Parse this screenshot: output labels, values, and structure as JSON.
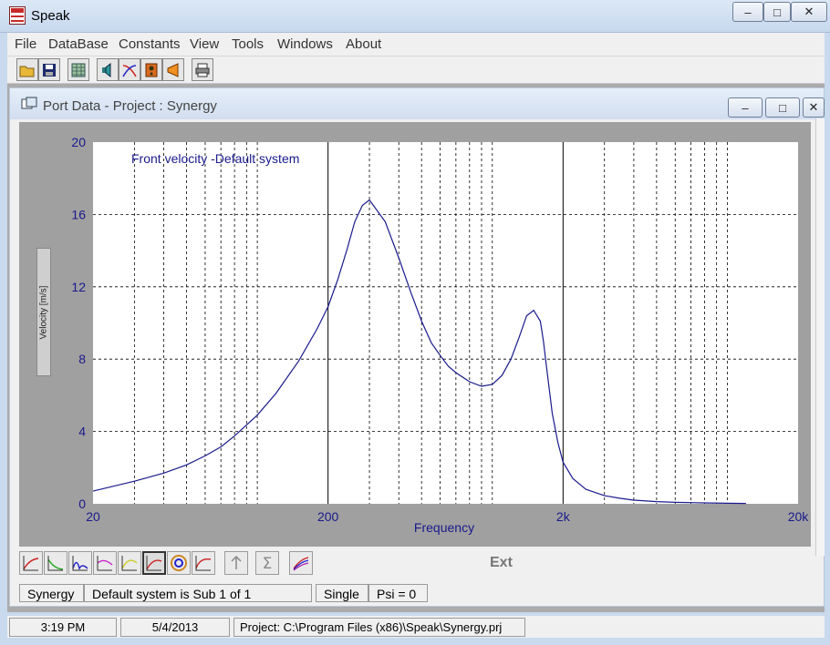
{
  "app": {
    "title": "Speak"
  },
  "window_controls": {
    "minimize": "‒",
    "maximize": "□",
    "close": "✕"
  },
  "menu": [
    "File",
    "DataBase",
    "Constants",
    "View",
    "Tools",
    "Windows",
    "About"
  ],
  "toolbar": {
    "icons": [
      "open-folder-icon",
      "save-icon",
      "grid-icon",
      "speaker-icon",
      "crossover-icon",
      "box-icon",
      "horn-icon",
      "print-icon"
    ]
  },
  "child_window": {
    "title": "Port Data - Project : Synergy",
    "controls": {
      "minimize": "‒",
      "maximize": "□",
      "close": "✕"
    }
  },
  "chart_data": {
    "type": "line",
    "title": "Front velocity -Default system",
    "xlabel": "Frequency",
    "ylabel": "Velocity  [m/s]",
    "xscale": "log",
    "xlim": [
      20,
      20000
    ],
    "ylim": [
      0,
      20
    ],
    "xticks": [
      20,
      200,
      2000,
      20000
    ],
    "xtick_labels": [
      "20",
      "200",
      "2k",
      "20k"
    ],
    "yticks": [
      0,
      4,
      8,
      12,
      16,
      20
    ],
    "grid": true,
    "series": [
      {
        "color": "#1a1a8c",
        "x": [
          20,
          25,
          30,
          40,
          50,
          60,
          70,
          80,
          100,
          120,
          150,
          180,
          200,
          220,
          240,
          260,
          280,
          300,
          350,
          400,
          450,
          500,
          550,
          600,
          650,
          700,
          800,
          900,
          1000,
          1100,
          1200,
          1300,
          1400,
          1500,
          1600,
          1650,
          1700,
          1800,
          1900,
          2000,
          2200,
          2500,
          3000,
          3500,
          4000,
          5000,
          6000,
          8000,
          10000,
          12000
        ],
        "y": [
          0.7,
          1.0,
          1.25,
          1.7,
          2.15,
          2.65,
          3.15,
          3.75,
          4.9,
          6.1,
          7.9,
          9.7,
          10.9,
          12.4,
          14.0,
          15.6,
          16.5,
          16.8,
          15.6,
          13.6,
          11.7,
          10.1,
          8.9,
          8.2,
          7.6,
          7.25,
          6.75,
          6.5,
          6.6,
          7.1,
          8.0,
          9.2,
          10.4,
          10.7,
          10.1,
          9.0,
          7.6,
          5.0,
          3.4,
          2.3,
          1.4,
          0.8,
          0.45,
          0.3,
          0.2,
          0.12,
          0.08,
          0.05,
          0.03,
          0.02
        ]
      }
    ]
  },
  "bottom_tools": {
    "ext_label": "Ext"
  },
  "status_row": {
    "project": "Synergy",
    "system": "Default system is Sub 1 of 1",
    "mode": "Single",
    "psi": "Psi = 0"
  },
  "statusbar": {
    "time": "3:19 PM",
    "date": "5/4/2013",
    "project_path": "Project: C:\\Program Files (x86)\\Speak\\Synergy.prj"
  }
}
